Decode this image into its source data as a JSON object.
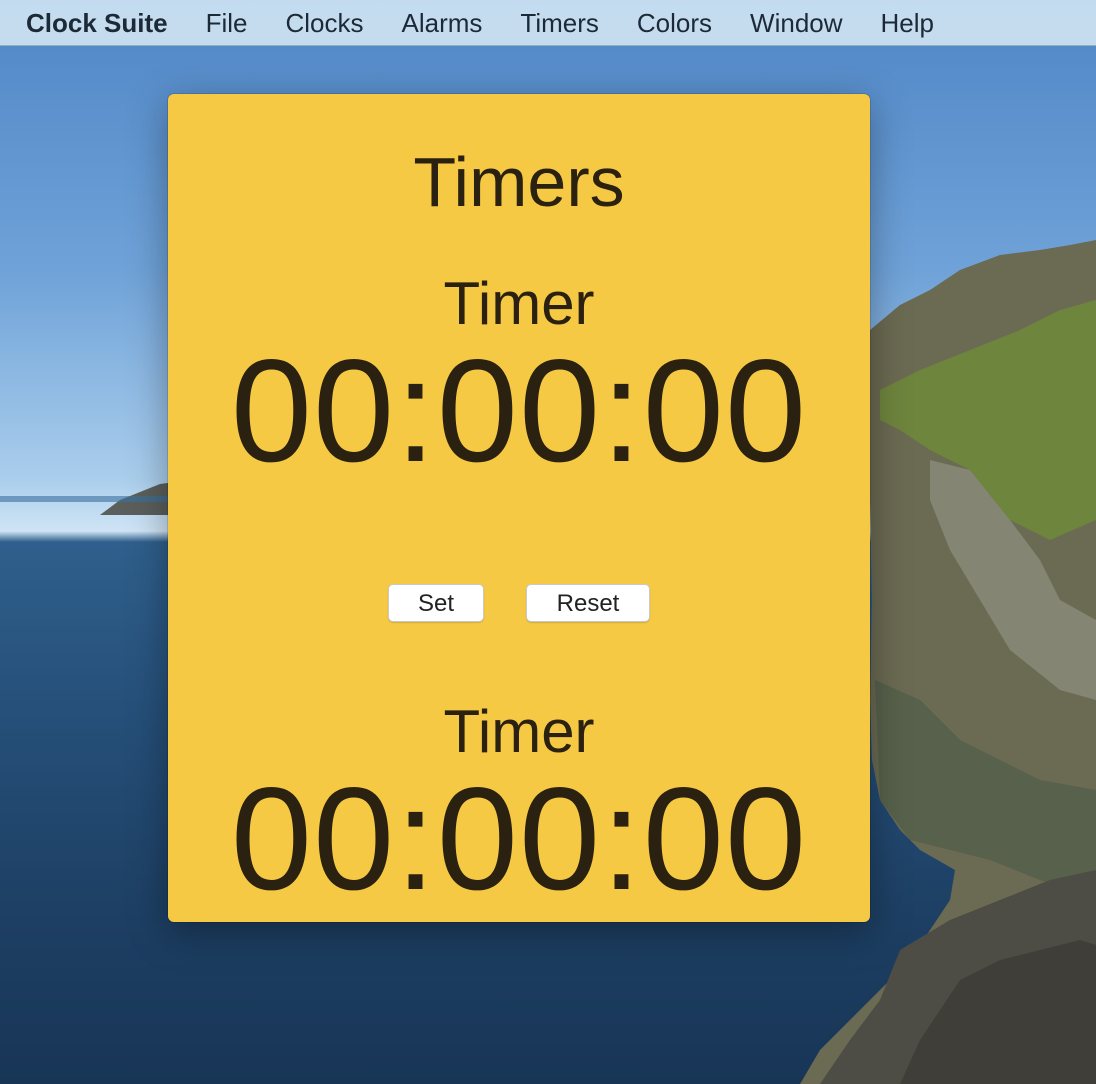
{
  "menubar": {
    "app_name": "Clock Suite",
    "items": [
      "File",
      "Clocks",
      "Alarms",
      "Timers",
      "Colors",
      "Window",
      "Help"
    ]
  },
  "window": {
    "title": "Timers",
    "background_color": "#f6c944",
    "timers": [
      {
        "label": "Timer",
        "display": "00:00:00"
      },
      {
        "label": "Timer",
        "display": "00:00:00"
      }
    ],
    "buttons": {
      "set_label": "Set",
      "reset_label": "Reset"
    }
  },
  "desktop": {
    "wallpaper": "coastal cliffs over ocean"
  }
}
